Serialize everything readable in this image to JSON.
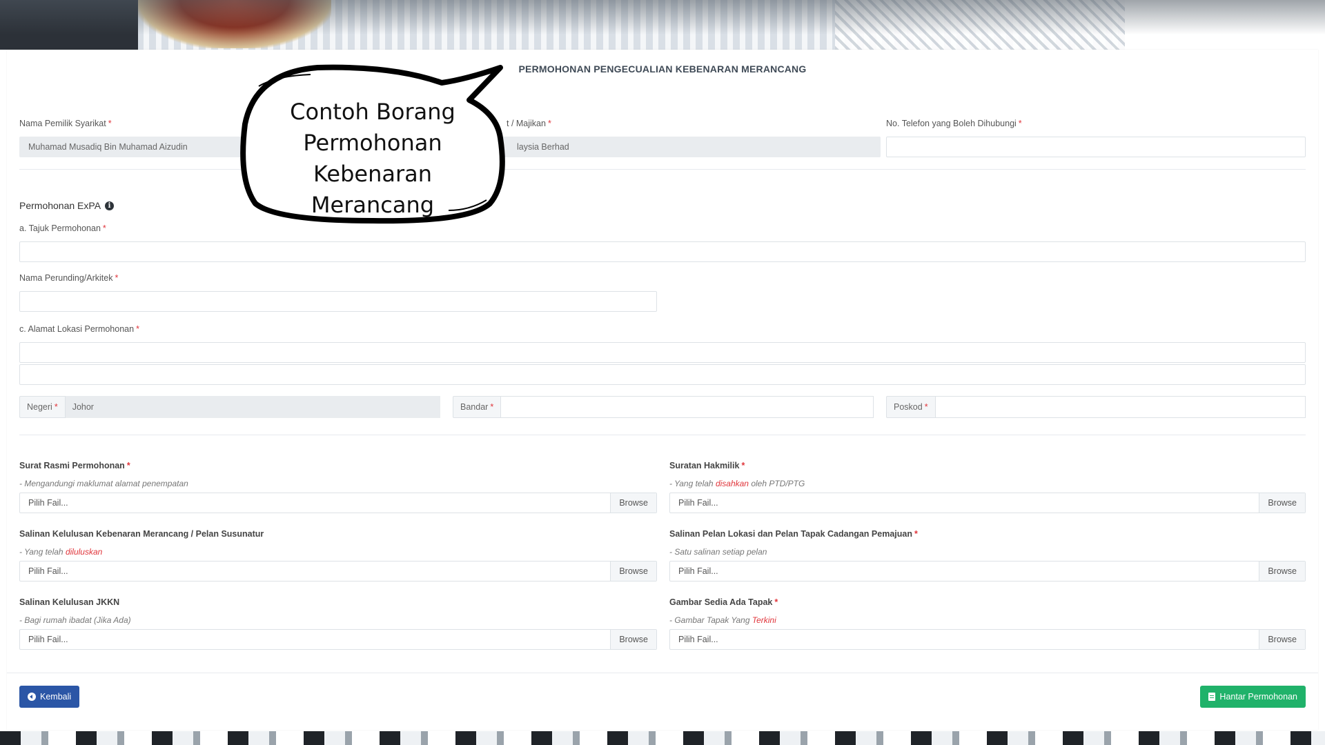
{
  "form": {
    "title": "PERMOHONAN PENGECUALIAN KEBENARAN MERANCANG",
    "owner_label": "Nama Pemilik Syarikat",
    "owner_value": "Muhamad Musadiq Bin Muhamad Aizudin",
    "company_label": "t / Majikan",
    "company_value": "laysia Berhad",
    "phone_label": "No. Telefon yang Boleh Dihubungi",
    "phone_value": "",
    "required_mark": "*"
  },
  "expa": {
    "heading": "Permohonan ExPA",
    "info_icon": "info-circle-icon",
    "title_label": "a. Tajuk Permohonan",
    "consultant_label": "Nama Perunding/Arkitek",
    "address_label": "c. Alamat Lokasi Permohonan",
    "state_label": "Negeri",
    "state_value": "Johor",
    "city_label": "Bandar",
    "postcode_label": "Poskod"
  },
  "uploads": [
    {
      "label": "Surat Rasmi Permohonan",
      "required": true,
      "hint_prefix": "- Mengandungi maklumat alamat penempatan",
      "hint_red": "",
      "hint_suffix": "",
      "placeholder": "Pilih Fail...",
      "browse": "Browse"
    },
    {
      "label": "Suratan Hakmilik",
      "required": true,
      "hint_prefix": "- Yang telah ",
      "hint_red": "disahkan",
      "hint_suffix": " oleh PTD/PTG",
      "placeholder": "Pilih Fail...",
      "browse": "Browse"
    },
    {
      "label": "Salinan Kelulusan Kebenaran Merancang / Pelan Susunatur",
      "required": false,
      "hint_prefix": "- Yang telah ",
      "hint_red": "diluluskan",
      "hint_suffix": "",
      "placeholder": "Pilih Fail...",
      "browse": "Browse"
    },
    {
      "label": "Salinan Pelan Lokasi dan Pelan Tapak Cadangan Pemajuan",
      "required": true,
      "hint_prefix": "- Satu salinan setiap pelan",
      "hint_red": "",
      "hint_suffix": "",
      "placeholder": "Pilih Fail...",
      "browse": "Browse"
    },
    {
      "label": "Salinan Kelulusan JKKN",
      "required": false,
      "hint_prefix": "- Bagi rumah ibadat (Jika Ada)",
      "hint_red": "",
      "hint_suffix": "",
      "placeholder": "Pilih Fail...",
      "browse": "Browse"
    },
    {
      "label": "Gambar Sedia Ada Tapak",
      "required": true,
      "hint_prefix": "- Gambar Tapak Yang ",
      "hint_red": "Terkini",
      "hint_suffix": "",
      "placeholder": "Pilih Fail...",
      "browse": "Browse"
    }
  ],
  "actions": {
    "back_label": "Kembali",
    "back_icon": "arrow-left-circle-icon",
    "submit_label": "Hantar Permohonan",
    "submit_icon": "clipboard-check-icon"
  },
  "colors": {
    "accent_blue": "#2b56a6",
    "success_green": "#20b26a",
    "required_red": "#e0353b"
  },
  "bubble": {
    "line1": "Contoh Borang",
    "line2": "Permohonan",
    "line3": "Kebenaran Merancang"
  }
}
